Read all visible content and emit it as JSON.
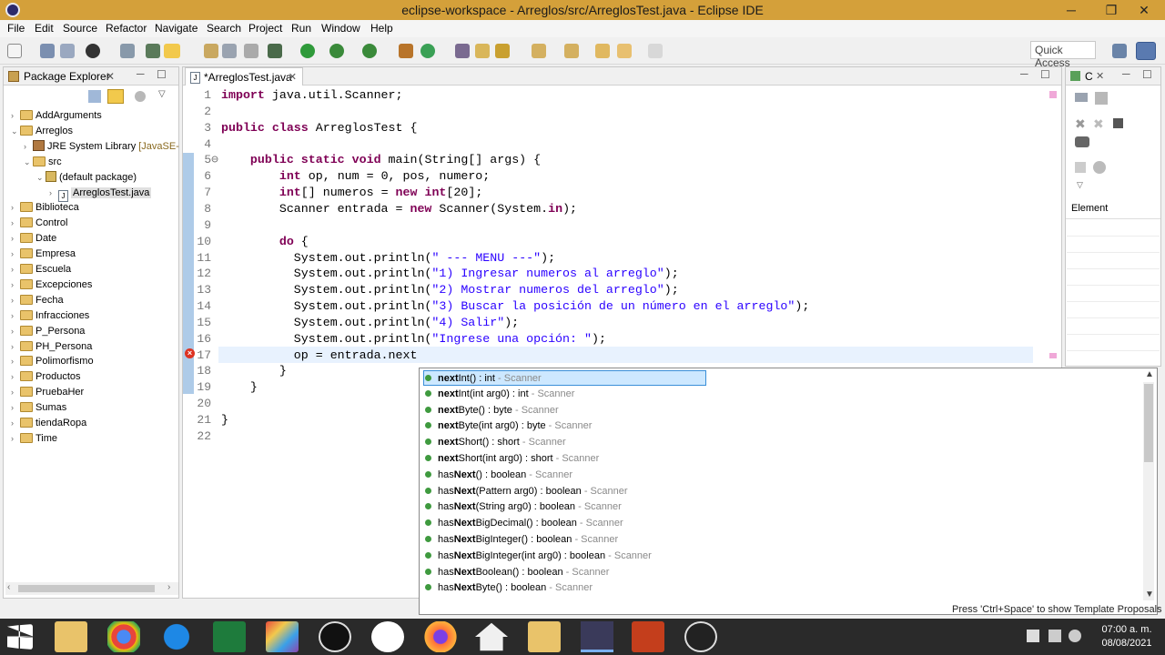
{
  "window": {
    "title": "eclipse-workspace - Arreglos/src/ArreglosTest.java - Eclipse IDE",
    "controls": [
      "─",
      "❐",
      "✕"
    ]
  },
  "menu": [
    "File",
    "Edit",
    "Source",
    "Refactor",
    "Navigate",
    "Search",
    "Project",
    "Run",
    "Window",
    "Help"
  ],
  "toolbar": {
    "quick_access": "Quick Access"
  },
  "package_explorer": {
    "title": "Package Explorer",
    "items": [
      {
        "label": "AddArguments",
        "expander": "›",
        "type": "project"
      },
      {
        "label": "Arreglos",
        "expander": "⌄",
        "type": "project"
      },
      {
        "label": "JRE System Library",
        "suffix": "[JavaSE-",
        "expander": "›",
        "type": "library"
      },
      {
        "label": "src",
        "expander": "⌄",
        "type": "folder"
      },
      {
        "label": "(default package)",
        "expander": "⌄",
        "type": "package"
      },
      {
        "label": "ArreglosTest.java",
        "expander": "›",
        "type": "java"
      },
      {
        "label": "Biblioteca",
        "expander": "›",
        "type": "project"
      },
      {
        "label": "Control",
        "expander": "›",
        "type": "project"
      },
      {
        "label": "Date",
        "expander": "›",
        "type": "project"
      },
      {
        "label": "Empresa",
        "expander": "›",
        "type": "project"
      },
      {
        "label": "Escuela",
        "expander": "›",
        "type": "project"
      },
      {
        "label": "Excepciones",
        "expander": "›",
        "type": "project"
      },
      {
        "label": "Fecha",
        "expander": "›",
        "type": "project"
      },
      {
        "label": "Infracciones",
        "expander": "›",
        "type": "project"
      },
      {
        "label": "P_Persona",
        "expander": "›",
        "type": "project"
      },
      {
        "label": "PH_Persona",
        "expander": "›",
        "type": "project"
      },
      {
        "label": "Polimorfismo",
        "expander": "›",
        "type": "project"
      },
      {
        "label": "Productos",
        "expander": "›",
        "type": "project"
      },
      {
        "label": "PruebaHer",
        "expander": "›",
        "type": "project"
      },
      {
        "label": "Sumas",
        "expander": "›",
        "type": "project"
      },
      {
        "label": "tiendaRopa",
        "expander": "›",
        "type": "project"
      },
      {
        "label": "Time",
        "expander": "›",
        "type": "project"
      }
    ]
  },
  "editor": {
    "tab_label": "*ArreglosTest.java",
    "lines": [
      {
        "n": "1",
        "code": [
          {
            "t": "import",
            "k": 1
          },
          {
            "t": " java.util.Scanner;"
          }
        ]
      },
      {
        "n": "2",
        "code": []
      },
      {
        "n": "3",
        "code": [
          {
            "t": "public class",
            "k": 1
          },
          {
            "t": " ArreglosTest {"
          }
        ]
      },
      {
        "n": "4",
        "code": []
      },
      {
        "n": "5⊖",
        "code": [
          {
            "t": "    "
          },
          {
            "t": "public static void",
            "k": 1
          },
          {
            "t": " main(String[] args) {"
          }
        ]
      },
      {
        "n": "6",
        "code": [
          {
            "t": "        "
          },
          {
            "t": "int",
            "k": 1
          },
          {
            "t": " op, num = 0, pos, numero;"
          }
        ]
      },
      {
        "n": "7",
        "code": [
          {
            "t": "        "
          },
          {
            "t": "int",
            "k": 1
          },
          {
            "t": "[] numeros = "
          },
          {
            "t": "new",
            "k": 1
          },
          {
            "t": " "
          },
          {
            "t": "int",
            "k": 1
          },
          {
            "t": "[20];"
          }
        ]
      },
      {
        "n": "8",
        "code": [
          {
            "t": "        Scanner entrada = "
          },
          {
            "t": "new",
            "k": 1
          },
          {
            "t": " Scanner(System."
          },
          {
            "t": "in",
            "k": 1
          },
          {
            "t": ");"
          }
        ]
      },
      {
        "n": "9",
        "code": []
      },
      {
        "n": "10",
        "code": [
          {
            "t": "        "
          },
          {
            "t": "do",
            "k": 1
          },
          {
            "t": " {"
          }
        ]
      },
      {
        "n": "11",
        "code": [
          {
            "t": "          System."
          },
          {
            "t": "out"
          },
          {
            "t": ".println("
          },
          {
            "t": "\" --- MENU ---\"",
            "s": 1
          },
          {
            "t": ");"
          }
        ]
      },
      {
        "n": "12",
        "code": [
          {
            "t": "          System.out.println("
          },
          {
            "t": "\"1) Ingresar numeros al arreglo\"",
            "s": 1
          },
          {
            "t": ");"
          }
        ]
      },
      {
        "n": "13",
        "code": [
          {
            "t": "          System.out.println("
          },
          {
            "t": "\"2) Mostrar numeros del arreglo\"",
            "s": 1
          },
          {
            "t": ");"
          }
        ]
      },
      {
        "n": "14",
        "code": [
          {
            "t": "          System.out.println("
          },
          {
            "t": "\"3) Buscar la posición de un número en el arreglo\"",
            "s": 1
          },
          {
            "t": ");"
          }
        ]
      },
      {
        "n": "15",
        "code": [
          {
            "t": "          System.out.println("
          },
          {
            "t": "\"4) Salir\"",
            "s": 1
          },
          {
            "t": ");"
          }
        ]
      },
      {
        "n": "16",
        "code": [
          {
            "t": "          System.out.println("
          },
          {
            "t": "\"Ingrese una opción: \"",
            "s": 1
          },
          {
            "t": ");"
          }
        ]
      },
      {
        "n": "17",
        "code": [
          {
            "t": "          op = entrada.next"
          }
        ]
      },
      {
        "n": "18",
        "code": [
          {
            "t": "        }"
          }
        ]
      },
      {
        "n": "19",
        "code": [
          {
            "t": "    }"
          }
        ]
      },
      {
        "n": "20",
        "code": []
      },
      {
        "n": "21",
        "code": [
          {
            "t": "}"
          }
        ]
      },
      {
        "n": "22",
        "code": []
      }
    ]
  },
  "outline": {
    "tab": "C",
    "column_header": "Element"
  },
  "autocomplete": {
    "suggestions": [
      {
        "pre": "",
        "bold": "next",
        "post": "Int() : int",
        "cls": " - Scanner",
        "selected": true
      },
      {
        "pre": "",
        "bold": "next",
        "post": "Int(int arg0) : int",
        "cls": " - Scanner"
      },
      {
        "pre": "",
        "bold": "next",
        "post": "Byte() : byte",
        "cls": " - Scanner"
      },
      {
        "pre": "",
        "bold": "next",
        "post": "Byte(int arg0) : byte",
        "cls": " - Scanner"
      },
      {
        "pre": "",
        "bold": "next",
        "post": "Short() : short",
        "cls": " - Scanner"
      },
      {
        "pre": "",
        "bold": "next",
        "post": "Short(int arg0) : short",
        "cls": " - Scanner"
      },
      {
        "pre": "has",
        "bold": "Next",
        "post": "() : boolean",
        "cls": " - Scanner"
      },
      {
        "pre": "has",
        "bold": "Next",
        "post": "(Pattern arg0) : boolean",
        "cls": " - Scanner"
      },
      {
        "pre": "has",
        "bold": "Next",
        "post": "(String arg0) : boolean",
        "cls": " - Scanner"
      },
      {
        "pre": "has",
        "bold": "Next",
        "post": "BigDecimal() : boolean",
        "cls": " - Scanner"
      },
      {
        "pre": "has",
        "bold": "Next",
        "post": "BigInteger() : boolean",
        "cls": " - Scanner"
      },
      {
        "pre": "has",
        "bold": "Next",
        "post": "BigInteger(int arg0) : boolean",
        "cls": " - Scanner"
      },
      {
        "pre": "has",
        "bold": "Next",
        "post": "Boolean() : boolean",
        "cls": " - Scanner"
      },
      {
        "pre": "has",
        "bold": "Next",
        "post": "Byte() : boolean",
        "cls": " - Scanner"
      }
    ],
    "hint": "Press 'Ctrl+Space' to show Template Proposals"
  },
  "taskbar": {
    "time": "07:00 a. m.",
    "date": "08/08/2021",
    "apps": [
      "start",
      "file-explorer",
      "chrome",
      "internet-explorer",
      "excel",
      "app-launcher",
      "camera-app",
      "hp-app",
      "firefox",
      "home-app",
      "folder-app",
      "eclipse",
      "powerpoint",
      "obs"
    ]
  }
}
